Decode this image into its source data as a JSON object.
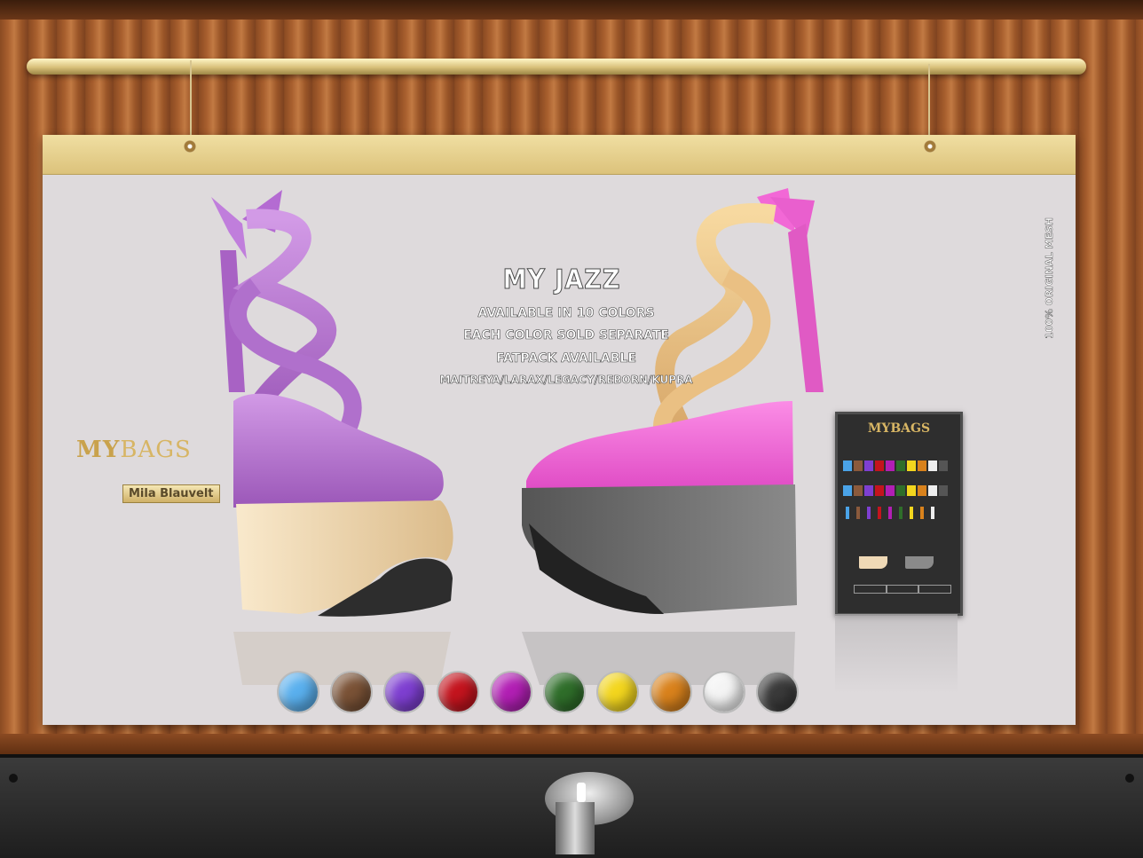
{
  "poster": {
    "title": "MY JAZZ",
    "lines": [
      "AVAILABLE IN 10 COLORS",
      "EACH COLOR SOLD SEPARATE",
      "FATPACK AVAILABLE",
      "MAITREYA/LARAX/LEGACY/REBORN/KUPRA"
    ],
    "brand_my": "MY",
    "brand_bags": "BAGS",
    "designer": "Mila Blauvelt",
    "vertical_text": "100% ORIGINAL MESH"
  },
  "vendor_mini": {
    "brand": "MYBAGS"
  },
  "swatches": [
    {
      "name": "blue-swatch",
      "color": "#5ab0ee"
    },
    {
      "name": "brown-swatch",
      "color": "#7a5236"
    },
    {
      "name": "purple-swatch",
      "color": "#7e3fd1"
    },
    {
      "name": "red-swatch",
      "color": "#c4141e"
    },
    {
      "name": "magenta-swatch",
      "color": "#b21fb4"
    },
    {
      "name": "green-swatch",
      "color": "#2f6e2a"
    },
    {
      "name": "yellow-swatch",
      "color": "#f3d61e"
    },
    {
      "name": "orange-swatch",
      "color": "#d9821c"
    },
    {
      "name": "white-swatch",
      "color": "#f4f4f4"
    },
    {
      "name": "black-swatch",
      "color": "#3a3a3a"
    }
  ],
  "colors": {
    "poster_bg": "#dedadc",
    "lilac_shoe": "#b878d2",
    "pink_shoe": "#f267d7",
    "cream_platform": "#efd9b6",
    "grey_platform": "#6f6f6f",
    "peach_ribbon": "#efc98c"
  }
}
